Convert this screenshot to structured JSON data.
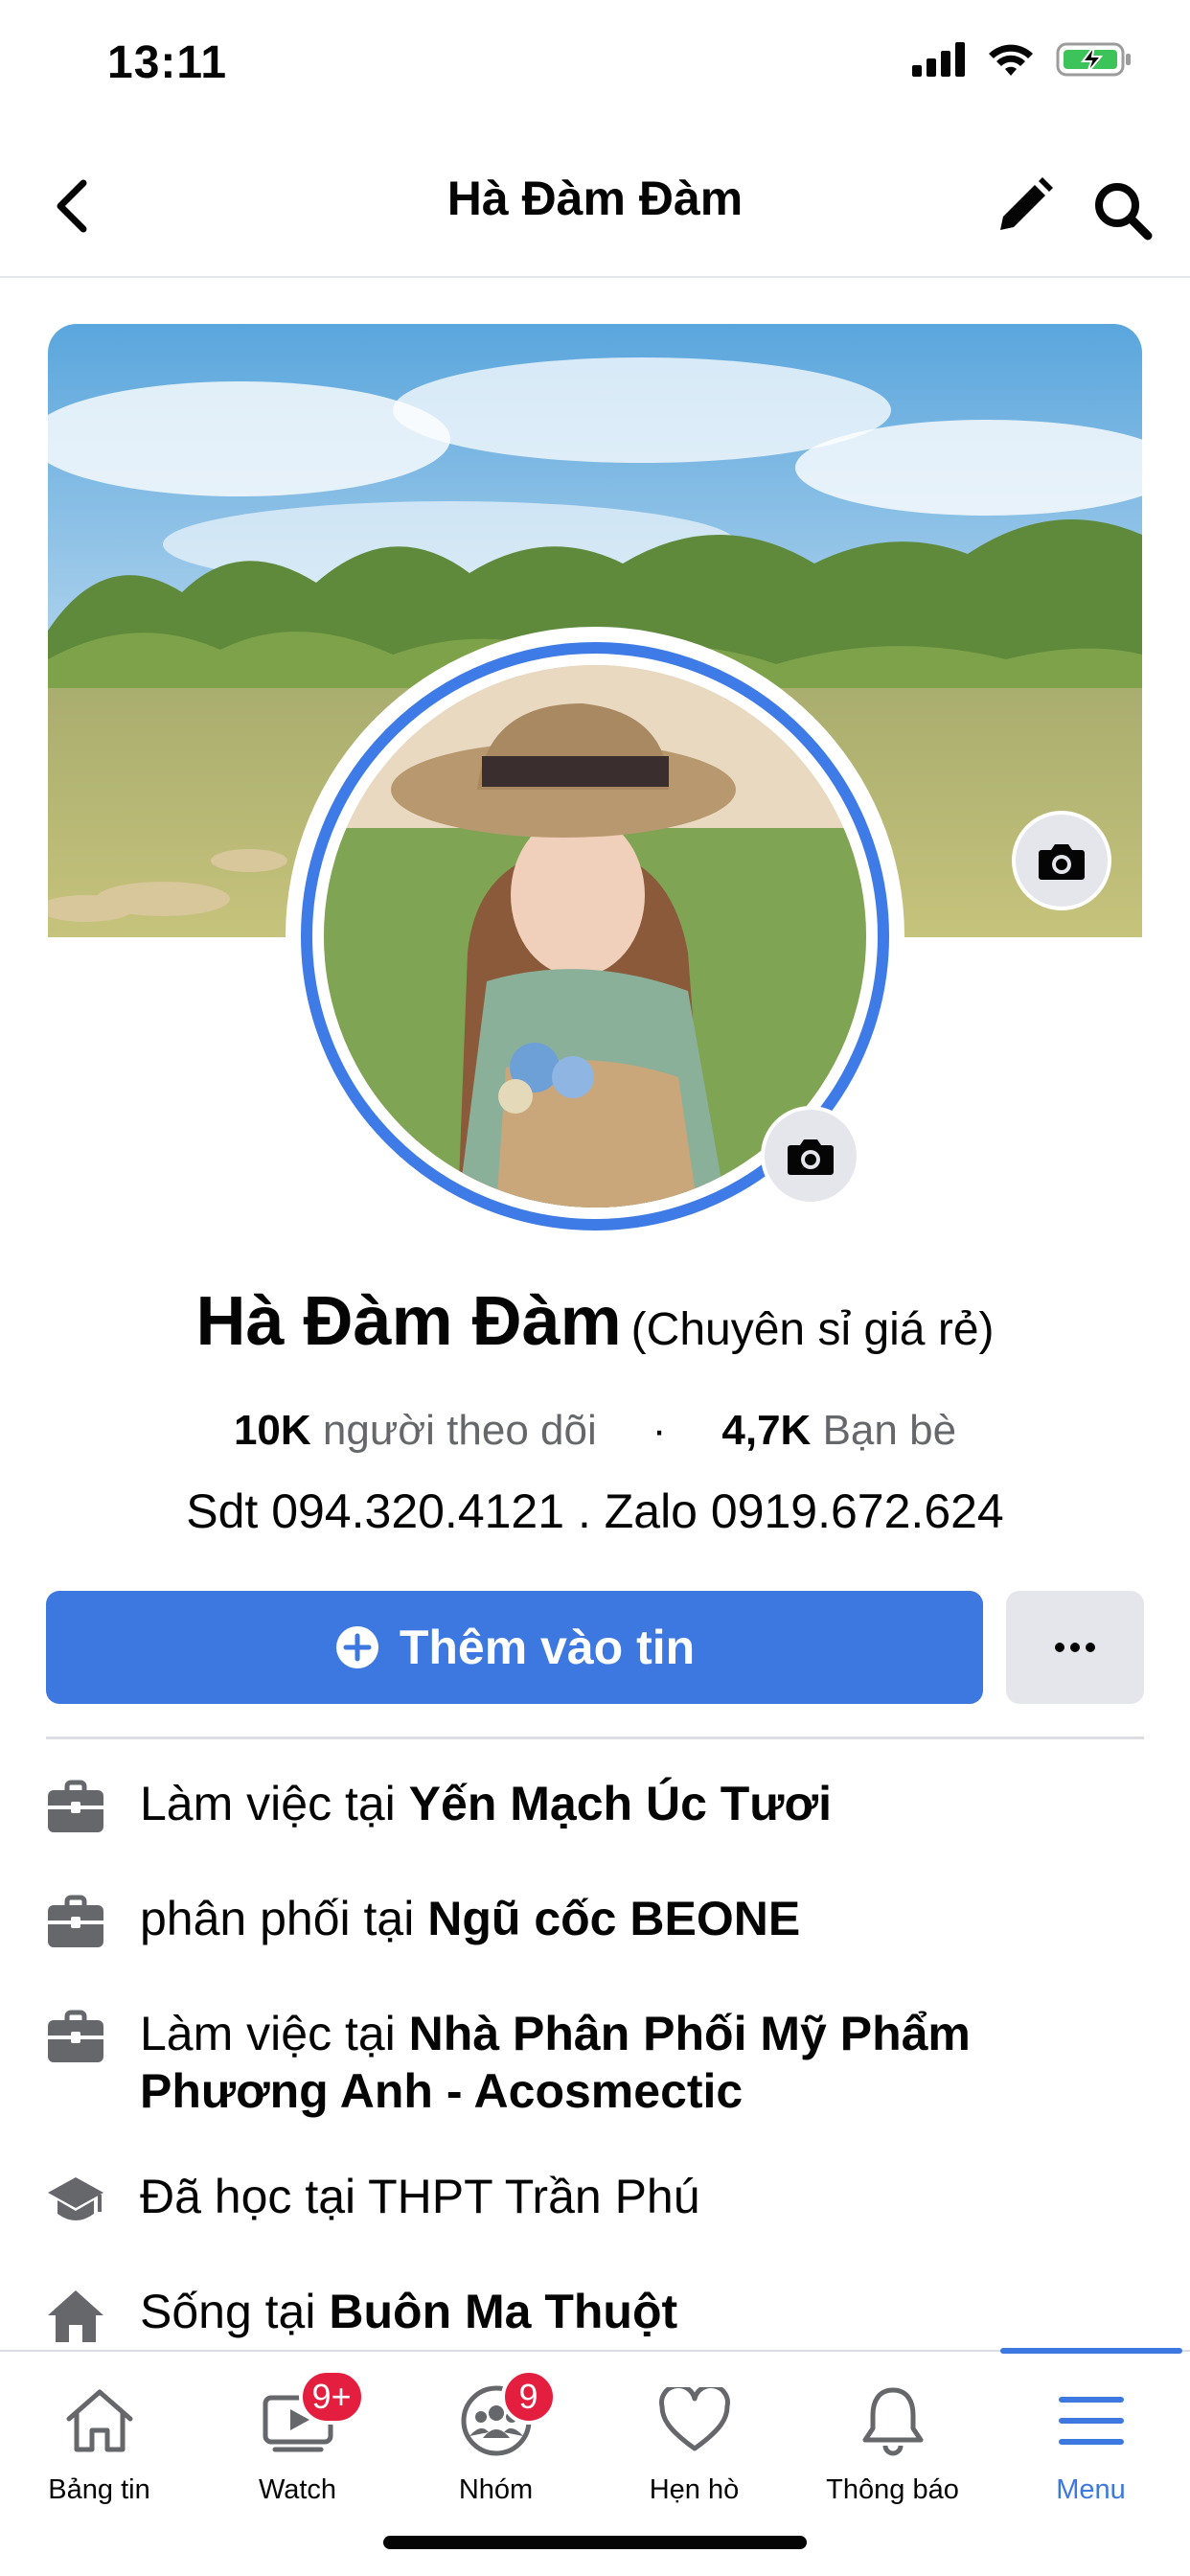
{
  "status_bar": {
    "time": "13:11"
  },
  "header": {
    "title": "Hà Đàm Đàm"
  },
  "profile": {
    "name": "Hà Đàm Đàm",
    "name_suffix": "(Chuyên sỉ giá rẻ)",
    "followers_count": "10K",
    "followers_label": "người theo dõi",
    "separator": "·",
    "friends_count": "4,7K",
    "friends_label": "Bạn bè",
    "contact": "Sdt 094.320.4121 . Zalo 0919.672.624"
  },
  "actions": {
    "add_story_label": "Thêm vào tin",
    "more_label": "•••"
  },
  "info": [
    {
      "icon": "briefcase-icon",
      "prefix": "Làm việc tại ",
      "value": "Yến Mạch Úc Tươi"
    },
    {
      "icon": "briefcase-icon",
      "prefix": "phân phối tại ",
      "value": "Ngũ cốc BEONE"
    },
    {
      "icon": "briefcase-icon",
      "prefix": "Làm việc tại ",
      "value": "Nhà Phân Phối Mỹ Phẩm Phương Anh - Acosmectic"
    },
    {
      "icon": "graduation-cap-icon",
      "prefix": "Đã học tại THPT Trần Phú",
      "value": ""
    },
    {
      "icon": "home-icon",
      "prefix": "Sống tại ",
      "value": "Buôn Ma Thuột"
    }
  ],
  "bottom_nav": {
    "items": [
      {
        "label": "Bảng tin",
        "icon": "home-outline-icon"
      },
      {
        "label": "Watch",
        "icon": "video-icon",
        "badge": "9+"
      },
      {
        "label": "Nhóm",
        "icon": "groups-icon",
        "badge": "9"
      },
      {
        "label": "Hẹn hò",
        "icon": "heart-icon"
      },
      {
        "label": "Thông báo",
        "icon": "bell-icon"
      },
      {
        "label": "Menu",
        "icon": "menu-icon",
        "active": true
      }
    ]
  },
  "colors": {
    "accent": "#3d77e0",
    "badge": "#e41e3f",
    "muted": "#65676b",
    "secondary_button": "#e4e6eb"
  }
}
